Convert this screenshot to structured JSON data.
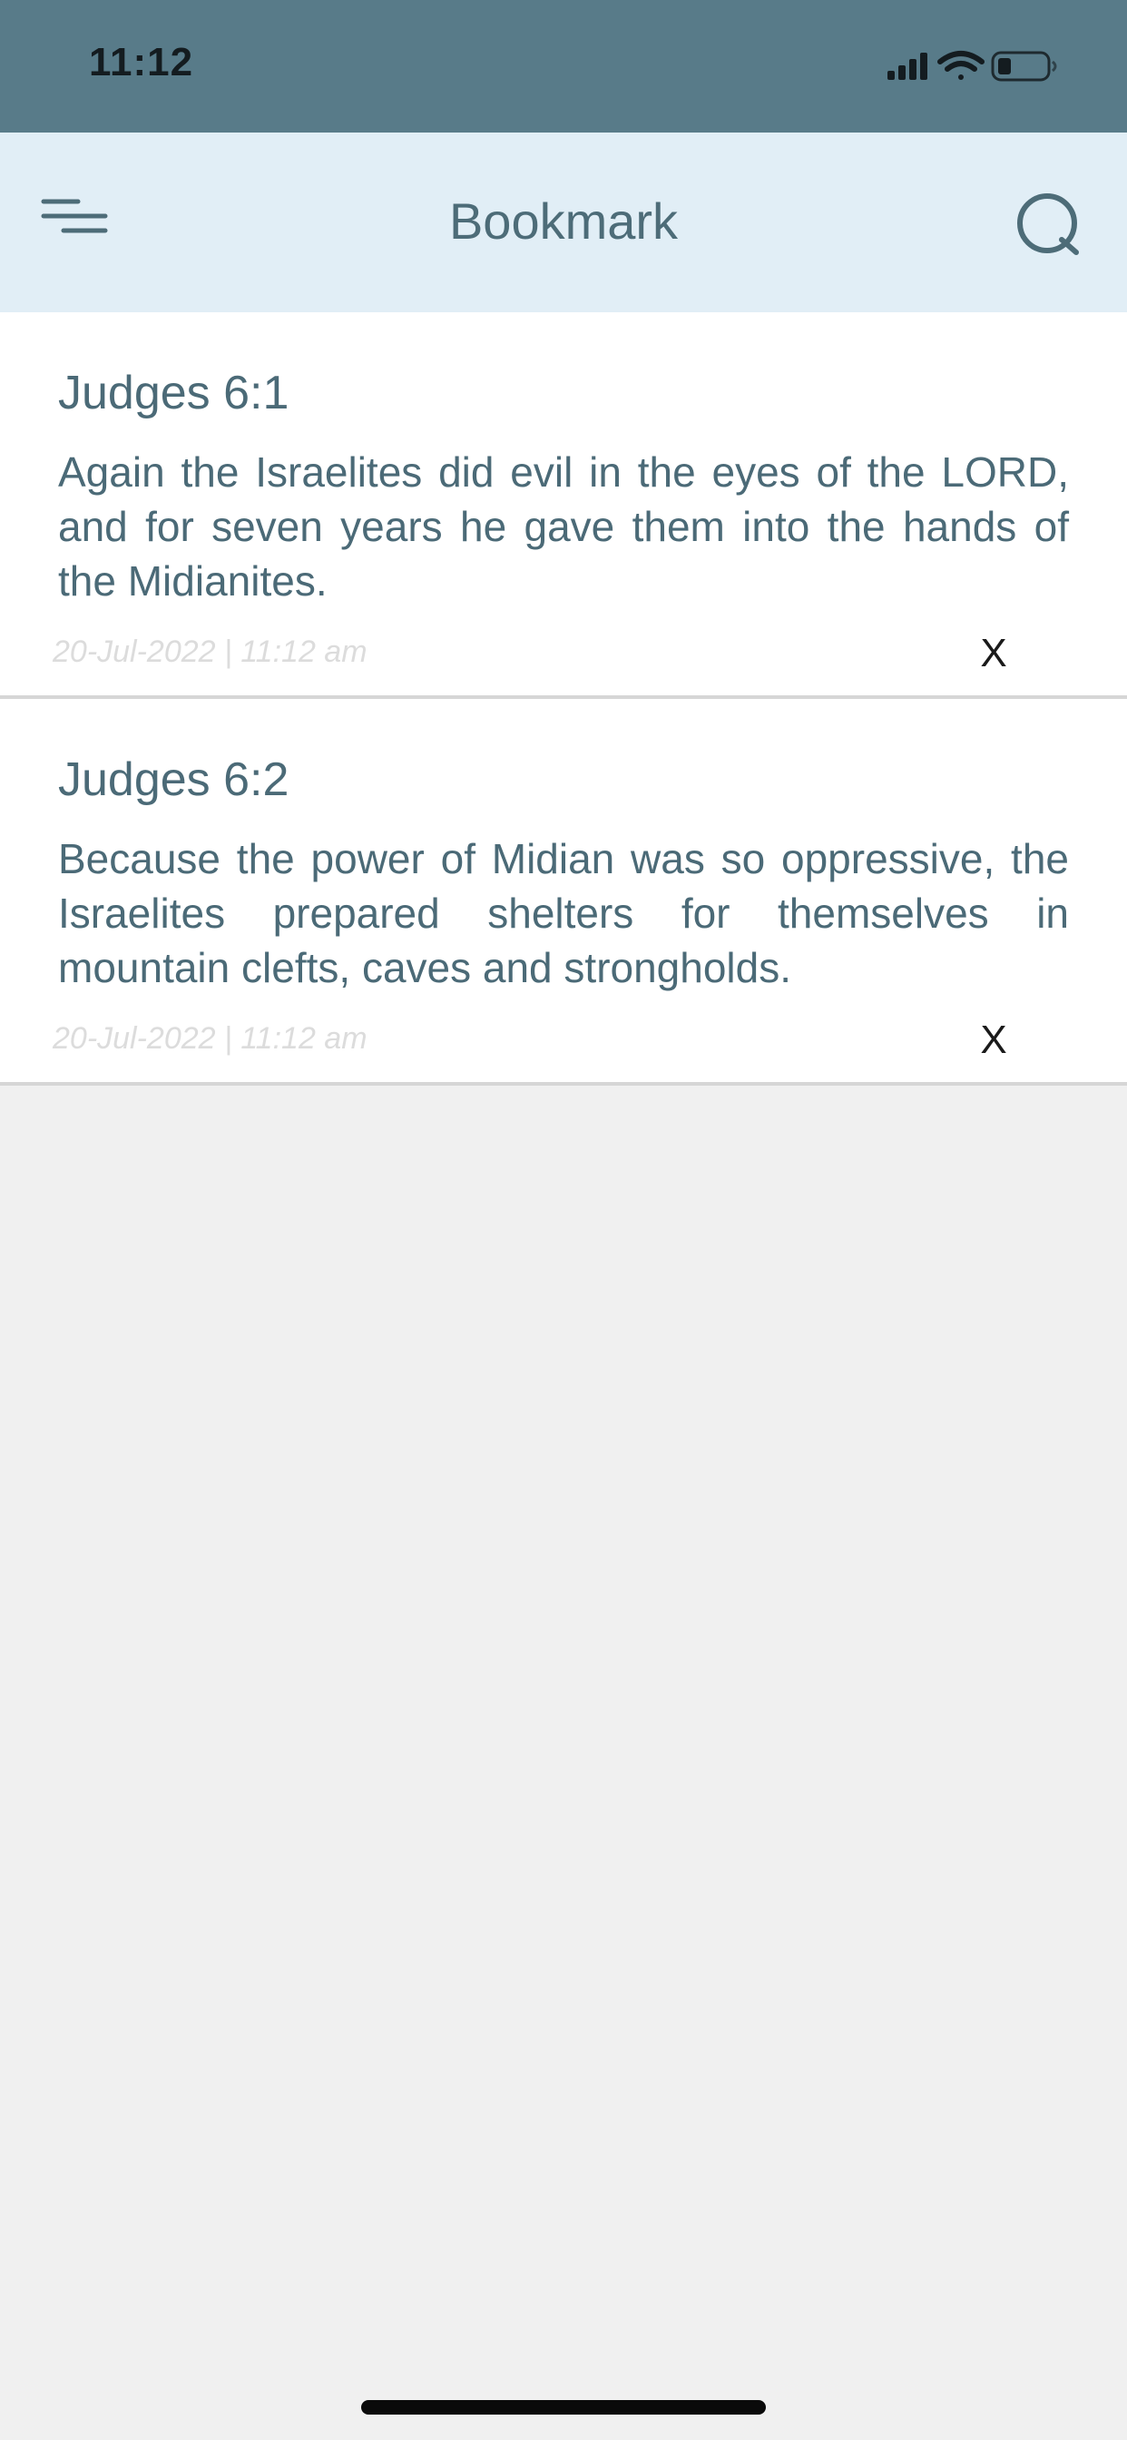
{
  "status_bar": {
    "time": "11:12",
    "icons": [
      "cellular-signal-icon",
      "wifi-icon",
      "battery-icon"
    ]
  },
  "header": {
    "title": "Bookmark",
    "menu_icon": "menu-icon",
    "search_icon": "search-icon"
  },
  "bookmarks": [
    {
      "reference": "Judges 6:1",
      "text": "Again the Israelites did evil in the eyes of the LORD, and for seven years he gave them into the hands of the Midianites.",
      "date": "20-Jul-2022 | 11:12 am",
      "delete_label": "X"
    },
    {
      "reference": "Judges 6:2",
      "text": "Because the power of Midian was so oppressive, the Israelites prepared shelters for themselves in mountain clefts, caves and strongholds.",
      "date": "20-Jul-2022 | 11:12 am",
      "delete_label": "X"
    }
  ],
  "colors": {
    "status_bar_bg": "#587b89",
    "header_bg": "#e1eef6",
    "accent_text": "#4b6a77",
    "page_bg": "#f0f0f0"
  }
}
